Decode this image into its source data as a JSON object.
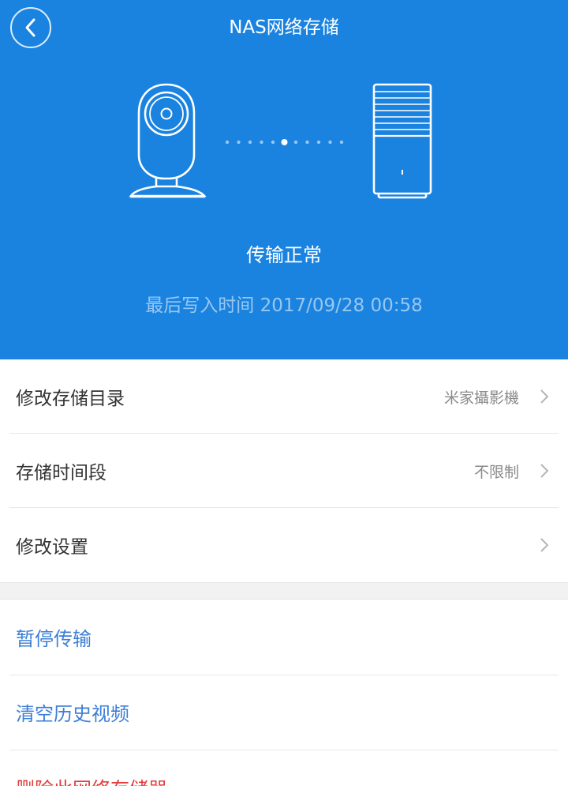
{
  "header": {
    "back_icon": "chevron-left-icon",
    "title": "NAS网络存储",
    "status": "传输正常",
    "last_write": "最后写入时间 2017/09/28 00:58",
    "background_color": "#1a83e0",
    "illustration": {
      "camera_icon": "camera-icon",
      "nas_icon": "nas-storage-icon",
      "transfer_dots_count": 11,
      "active_dot_index": 5
    }
  },
  "settings": {
    "items": [
      {
        "label": "修改存储目录",
        "value": "米家攝影機"
      },
      {
        "label": "存储时间段",
        "value": "不限制"
      },
      {
        "label": "修改设置",
        "value": ""
      }
    ]
  },
  "actions": {
    "pause": "暂停传输",
    "clear_history": "清空历史视频",
    "remove_storage": "删除此网络存储器"
  },
  "colors": {
    "accent_blue": "#3d7fd6",
    "danger_red": "#e53b3b"
  }
}
